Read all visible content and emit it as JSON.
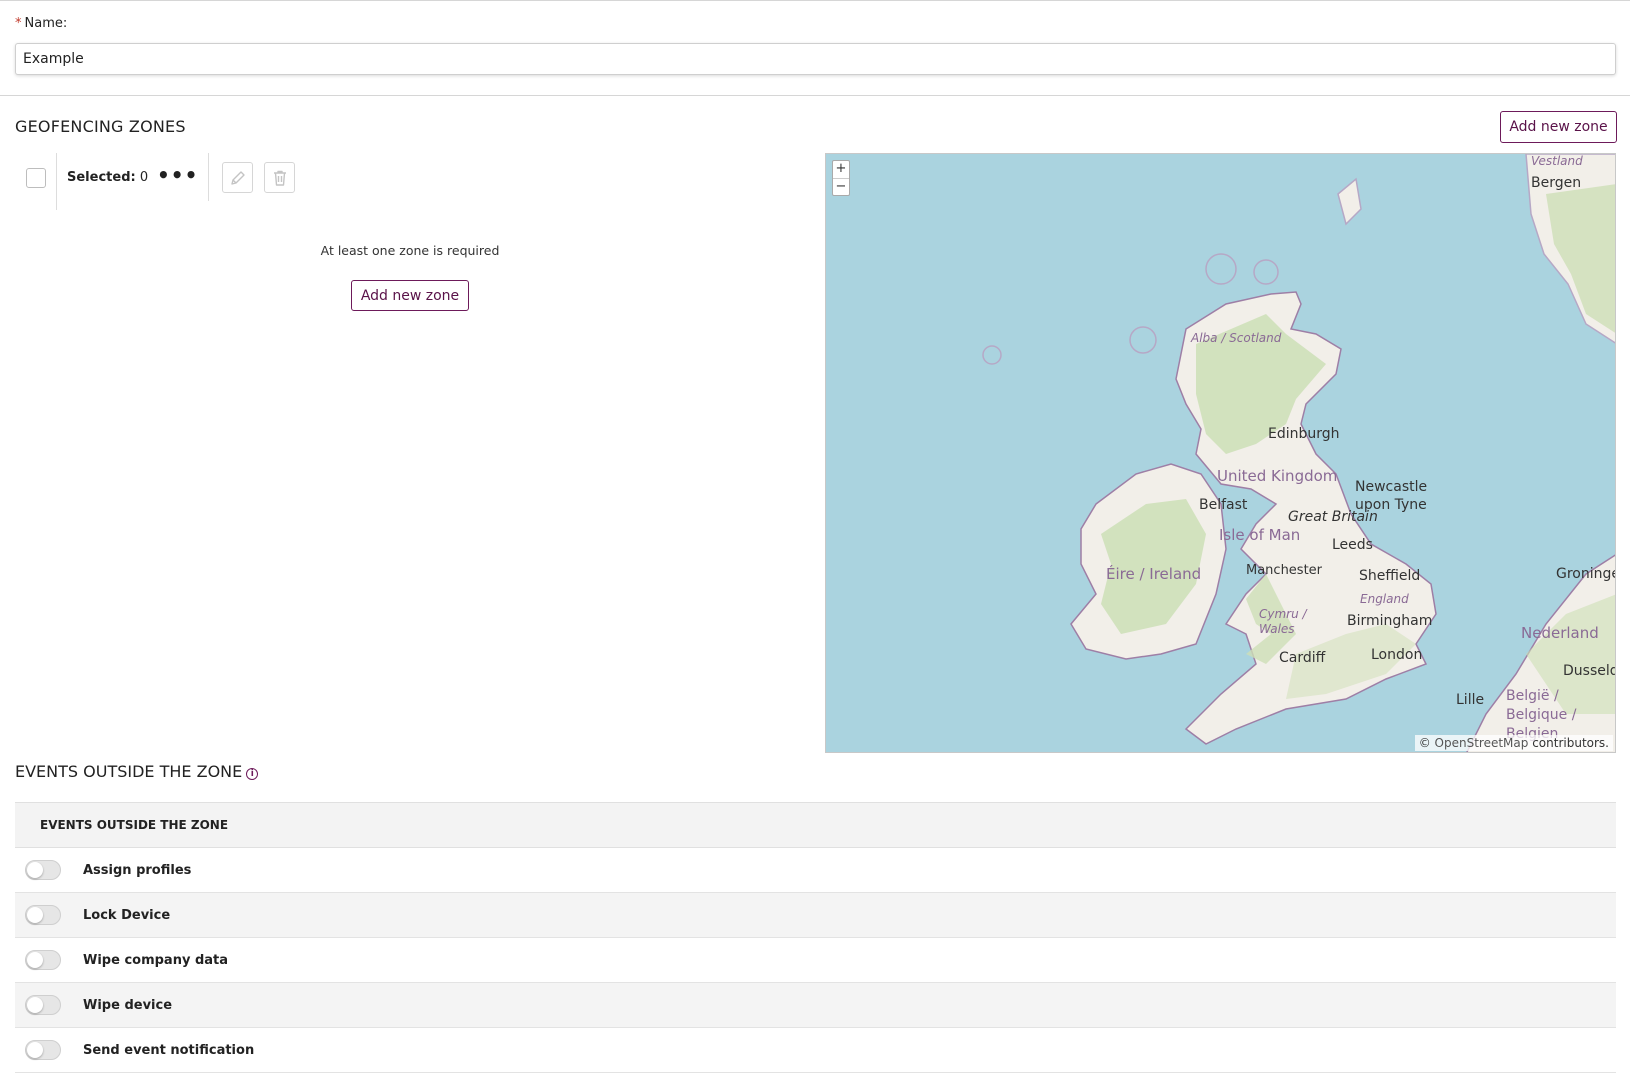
{
  "name_field": {
    "label": "Name:",
    "required_marker": "*",
    "value": "Example"
  },
  "geofencing": {
    "title": "GEOFENCING ZONES",
    "add_zone_label": "Add new zone",
    "toolbar": {
      "selected_label": "Selected:",
      "selected_count": "0",
      "more_icon": "ellipsis-icon",
      "edit_icon": "pencil-icon",
      "delete_icon": "trash-icon"
    },
    "empty_message": "At least one zone is required",
    "empty_add_label": "Add new zone"
  },
  "map": {
    "zoom_in": "+",
    "zoom_out": "−",
    "attribution_prefix": "©",
    "attribution_link": "OpenStreetMap",
    "attribution_suffix": "contributors.",
    "colors": {
      "sea": "#aad3df",
      "land": "#f2efe9",
      "green": "#cddfb6",
      "border": "#9e7fa6"
    },
    "labels": {
      "vestland": "Vestland",
      "bergen": "Bergen",
      "scotland": "Alba / Scotland",
      "edinburgh": "Edinburgh",
      "uk": "United Kingdom",
      "newcastle": "Newcastle upon Tyne",
      "belfast": "Belfast",
      "great_britain": "Great Britain",
      "isle_of_man": "Isle of Man",
      "leeds": "Leeds",
      "ireland": "Éire / Ireland",
      "manchester": "Manchester",
      "sheffield": "Sheffield",
      "england": "England",
      "wales": "Cymru / Wales",
      "birmingham": "Birmingham",
      "cardiff": "Cardiff",
      "london": "London",
      "groningen": "Groninge",
      "nederland": "Nederland",
      "dusseldorf": "Dusseld",
      "lille": "Lille",
      "belgie": "België / Belgique / Belgien"
    }
  },
  "events": {
    "title": "EVENTS OUTSIDE THE ZONE",
    "info_icon": "info-icon",
    "table_header": "EVENTS OUTSIDE THE ZONE",
    "rows": [
      {
        "label": "Assign profiles",
        "enabled": false
      },
      {
        "label": "Lock Device",
        "enabled": false
      },
      {
        "label": "Wipe company data",
        "enabled": false
      },
      {
        "label": "Wipe device",
        "enabled": false
      },
      {
        "label": "Send event notification",
        "enabled": false
      }
    ]
  }
}
